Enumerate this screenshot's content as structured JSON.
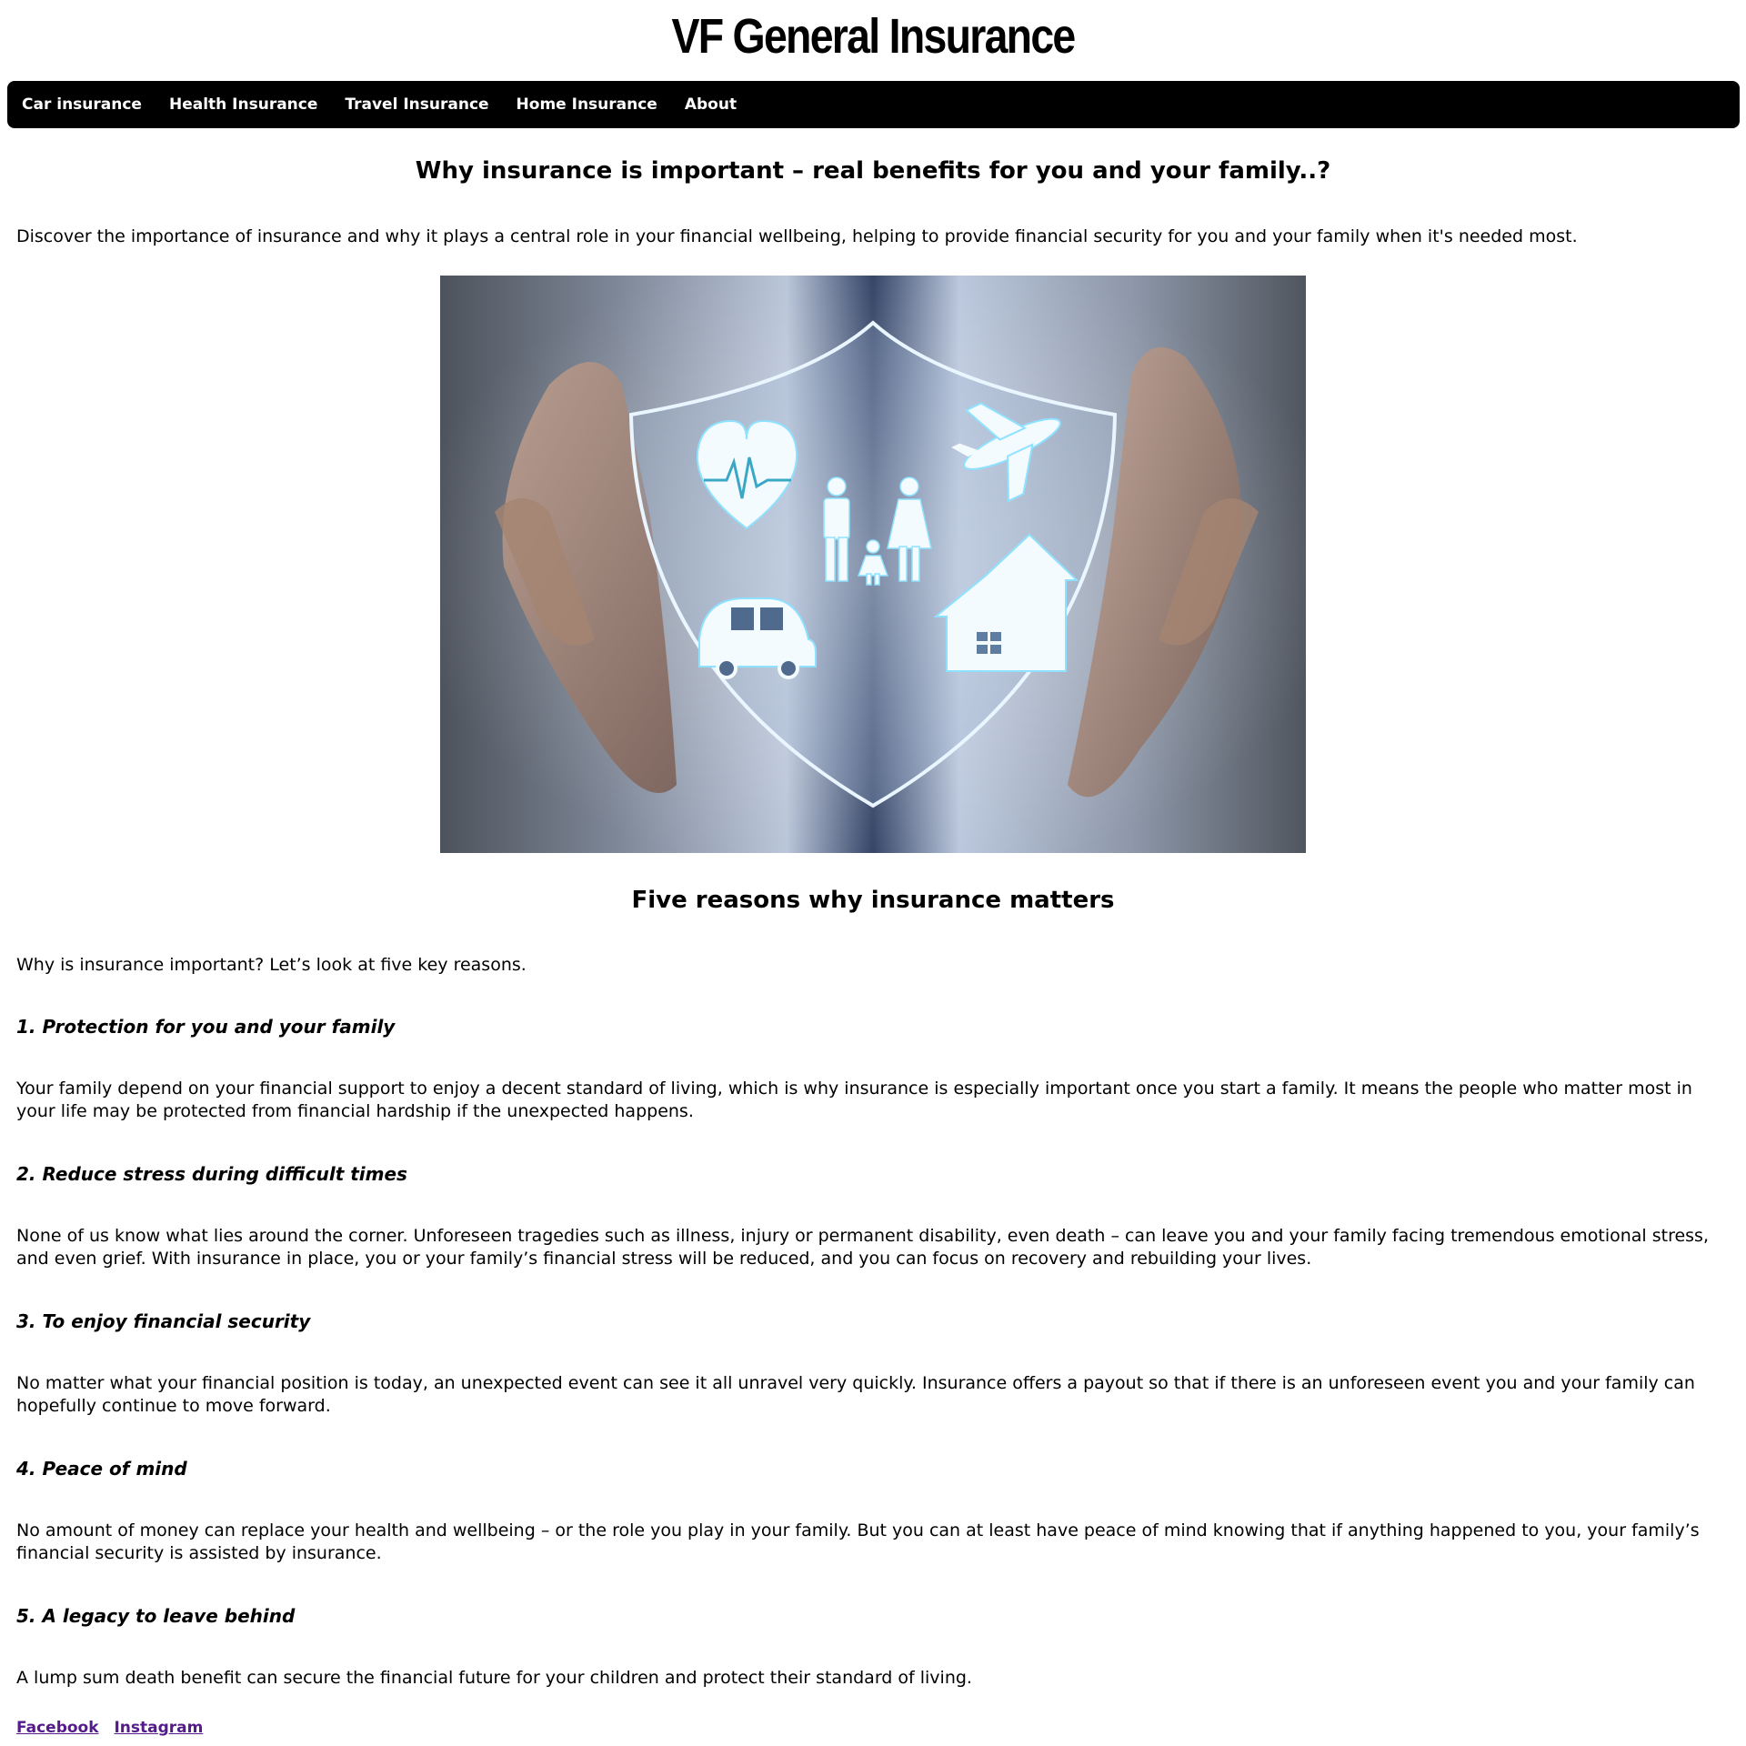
{
  "header": {
    "site_title": "VF General Insurance"
  },
  "nav": {
    "items": [
      {
        "label": "Car insurance"
      },
      {
        "label": "Health Insurance"
      },
      {
        "label": "Travel Insurance"
      },
      {
        "label": "Home Insurance"
      },
      {
        "label": "About"
      }
    ]
  },
  "main": {
    "heading": "Why insurance is important – real benefits for you and your family..?",
    "intro": "Discover the importance of insurance and why it plays a central role in your financial wellbeing, helping to provide financial security for you and your family when it's needed most.",
    "hero_image_icons": [
      "heart-pulse-icon",
      "airplane-icon",
      "family-icon",
      "car-icon",
      "house-icon",
      "shield-icon"
    ],
    "reasons_heading": "Five reasons why insurance matters",
    "reasons_intro": "Why is insurance important? Let’s look at five key reasons.",
    "reasons": [
      {
        "title": "1. Protection for you and your family",
        "body": "Your family depend on your financial support to enjoy a decent standard of living, which is why insurance is especially important once you start a family. It means the people who matter most in your life may be protected from financial hardship if the unexpected happens."
      },
      {
        "title": "2. Reduce stress during difficult times",
        "body": "None of us know what lies around the corner. Unforeseen tragedies such as illness, injury or permanent disability, even death – can leave you and your family facing tremendous emotional stress, and even grief. With insurance in place, you or your family’s financial stress will be reduced, and you can focus on recovery and rebuilding your lives."
      },
      {
        "title": "3. To enjoy financial security",
        "body": "No matter what your financial position is today, an unexpected event can see it all unravel very quickly. Insurance offers a payout so that if there is an unforeseen event you and your family can hopefully continue to move forward."
      },
      {
        "title": "4. Peace of mind",
        "body": "No amount of money can replace your health and wellbeing – or the role you play in your family. But you can at least have peace of mind knowing that if anything happened to you, your family’s financial security is assisted by insurance."
      },
      {
        "title": "5. A legacy to leave behind",
        "body": "A lump sum death benefit can secure the financial future for your children and protect their standard of living."
      }
    ]
  },
  "footer": {
    "links": [
      {
        "label": "Facebook"
      },
      {
        "label": "Instagram"
      }
    ]
  },
  "colors": {
    "nav_background": "#000000",
    "nav_text": "#ffffff",
    "visited_link": "#551a8b"
  }
}
